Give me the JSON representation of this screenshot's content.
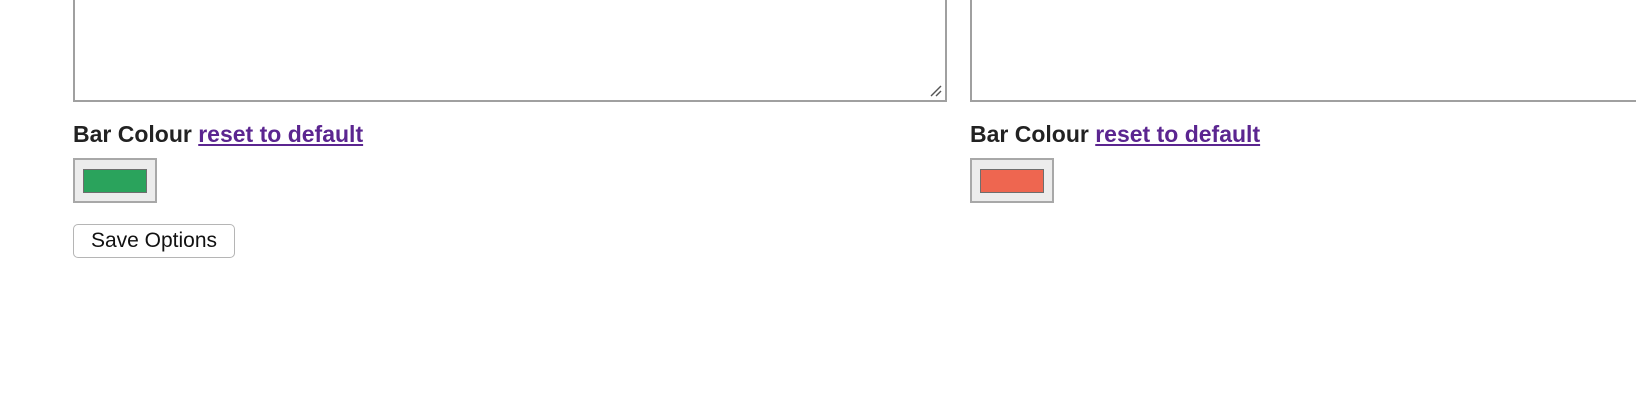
{
  "columns": [
    {
      "bar_colour_label": "Bar Colour",
      "reset_link_label": "reset to default",
      "bar_colour": "#2aa35c"
    },
    {
      "bar_colour_label": "Bar Colour",
      "reset_link_label": "reset to default",
      "bar_colour": "#ee6650"
    }
  ],
  "actions": {
    "save_label": "Save Options"
  },
  "colors": {
    "link": "#5b2590",
    "text": "#222222"
  }
}
